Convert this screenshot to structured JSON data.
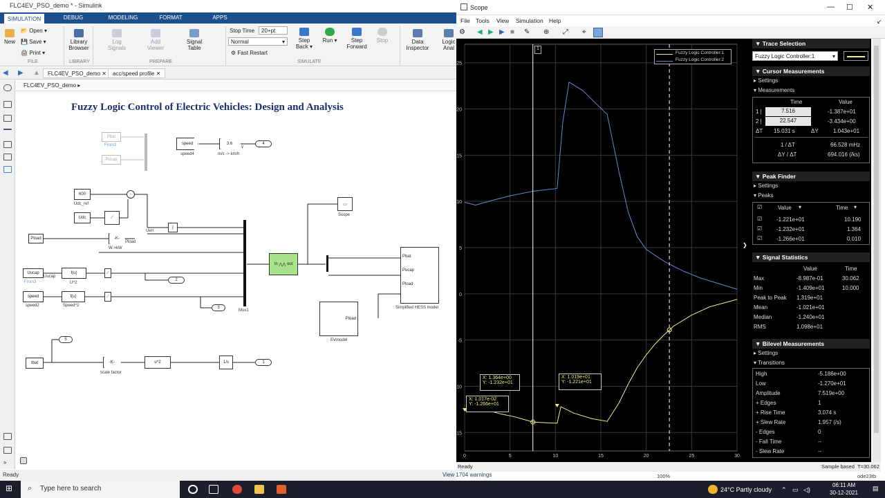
{
  "simulink": {
    "window_title": "FLC4EV_PSO_demo * - Simulink",
    "tabs": [
      "SIMULATION",
      "DEBUG",
      "MODELING",
      "FORMAT",
      "APPS"
    ],
    "ribbon": {
      "file": {
        "new": "New",
        "open": "Open",
        "save": "Save",
        "print": "Print",
        "section": "FILE"
      },
      "library": {
        "browser": "Library Browser",
        "section": "LIBRARY"
      },
      "prepare": {
        "log_signals": "Log Signals",
        "add_viewer": "Add Viewer",
        "signal_table": "Signal Table",
        "section": "PREPARE"
      },
      "simulate": {
        "stop_time_label": "Stop Time",
        "stop_time_value": "20+pt",
        "mode": "Normal",
        "fast_restart": "Fast Restart",
        "step_back": "Step Back",
        "run": "Run",
        "step_forward": "Step Forward",
        "stop": "Stop",
        "section": "SIMULATE"
      },
      "review": {
        "data_inspector": "Data Inspector",
        "logic_analyzer": "Logic Anal"
      }
    },
    "doc_tabs": [
      "FLC4EV_PSO_demo",
      "acc/speed profile"
    ],
    "breadcrumb": "FLC4EV_PSO_demo",
    "model_title": "Fuzzy Logic Control of Electric Vehicles: Design and Analysis",
    "blocks": {
      "speed4": "speed",
      "speed4_lbl": "speed4",
      "gain36": "3.6",
      "v": "v",
      "ms_kmh": "m/s -> km/h",
      "out4": "4",
      "pbat_g": "Pbat",
      "from2": "From2",
      "pucap_g": "Pucap",
      "c600": "600",
      "udc_ref": "Udc_ref",
      "udc": "Udc",
      "uerr": "Uerr",
      "pload": "Pload",
      "kgain": "-K-",
      "w_kw": "W->kW",
      "pload2": "Pload",
      "uucap": "Uucap",
      "from3": "From3",
      "uucap2": "Uucap",
      "fu": "f(u)",
      "u2": "U^2",
      "out2": "2",
      "speed2": "speed",
      "speed2_lbl": "speed2",
      "fu2": "f(u)",
      "speedsq": "Speed^2",
      "out3": "3",
      "mux": "Mux1",
      "scope": "Scope",
      "flc_in": "In",
      "flc_out": "out",
      "hess_pbat": "Pbat",
      "hess_pucap": "Pucap",
      "hess_pload": "Pload",
      "hess": "Simplified HESS model",
      "ev_pload": "Pload",
      "evmodel": "EVmodel",
      "out5": "5",
      "ibat": "Ibat",
      "scale": "scale factor",
      "usq": "u^2",
      "integ": "1/s",
      "out1": "1"
    },
    "status": {
      "left": "Ready",
      "warnings": "View 1704 warnings",
      "zoom": "100%"
    }
  },
  "scope": {
    "window_title": "Scope",
    "menu": [
      "File",
      "Tools",
      "View",
      "Simulation",
      "Help"
    ],
    "legend": [
      "Fuzzy Logic  Controller:1",
      "Fuzzy Logic  Controller:2"
    ],
    "cursor_tag": "1",
    "y_ticks": [
      "25",
      "20",
      "15",
      "10",
      "5",
      "0",
      "-5",
      "-10",
      "-15"
    ],
    "x_ticks": [
      "0",
      "5",
      "10",
      "15",
      "20",
      "25",
      "30"
    ],
    "tips": [
      {
        "x": "X:  1.364e+00",
        "y": "Y: -1.232e+01"
      },
      {
        "x": "X:  1.017e-02",
        "y": "Y: -1.266e+01"
      },
      {
        "x": "X:  1.019e+01",
        "y": "Y: -1.221e+01"
      }
    ],
    "status": {
      "left": "Ready",
      "sample": "Sample based",
      "time": "T=30.062"
    },
    "colors": {
      "trace1": "#f0f08a",
      "trace2": "#5b8fd6",
      "grid": "#3a3a3a",
      "bg": "#000000"
    }
  },
  "chart_data": {
    "type": "line",
    "xlim": [
      0,
      30
    ],
    "ylim": [
      -17,
      27
    ],
    "series": [
      {
        "name": "Fuzzy Logic  Controller:1",
        "x": [
          0,
          1.36,
          2.5,
          4,
          5.5,
          7.516,
          9,
          10.19,
          10.6,
          12,
          14,
          15.7,
          17,
          18,
          19,
          20,
          21,
          22,
          23,
          25,
          27,
          30
        ],
        "y": [
          -12.66,
          -12.32,
          -12.6,
          -13.0,
          -13.3,
          -13.87,
          -13.95,
          -14.0,
          -12.21,
          -12.9,
          -13.5,
          -13.8,
          -11.8,
          -9.8,
          -8.0,
          -6.6,
          -5.4,
          -4.4,
          -3.5,
          -2.3,
          -1.4,
          -0.6
        ]
      },
      {
        "name": "Fuzzy Logic  Controller:2",
        "x": [
          0,
          1.2,
          3,
          5,
          7.5,
          10.19,
          10.8,
          11.5,
          13,
          15.7,
          17,
          18,
          19,
          20,
          22,
          24,
          26,
          28,
          30
        ],
        "y": [
          9.9,
          9.6,
          10.1,
          10.6,
          11.1,
          11.4,
          18.5,
          22.9,
          22.0,
          19.4,
          13.2,
          8.9,
          6.2,
          4.8,
          3.5,
          2.5,
          1.7,
          1.1,
          0.5
        ]
      }
    ],
    "cursors": [
      7.516,
      22.547
    ]
  },
  "panel": {
    "trace_selection": {
      "title": "Trace Selection",
      "value": "Fuzzy Logic  Controller:1"
    },
    "cursor": {
      "title": "Cursor Measurements",
      "settings": "Settings",
      "measurements": "Measurements",
      "h_time": "Time",
      "h_value": "Value",
      "r1_idx": "1 |",
      "r1_time": "7.516",
      "r1_value": "-1.387e+01",
      "r2_idx": "2 |",
      "r2_time": "22.547",
      "r2_value": "-3.434e+00",
      "dt_lbl": "ΔT",
      "dt": "15.031 s",
      "dy_lbl": "ΔY",
      "dy": "1.043e+01",
      "inv_lbl": "1 / ΔT",
      "inv": "66.528 mHz",
      "slope_lbl": "ΔY / ΔT",
      "slope": "694.016 (/ks)"
    },
    "peak": {
      "title": "Peak Finder",
      "settings": "Settings",
      "peaks": "Peaks",
      "h_value": "Value",
      "h_time": "Time",
      "rows": [
        {
          "value": "-1.221e+01",
          "time": "10.190"
        },
        {
          "value": "-1.232e+01",
          "time": "1.364"
        },
        {
          "value": "-1.266e+01",
          "time": "0.010"
        }
      ]
    },
    "stats": {
      "title": "Signal Statistics",
      "h_value": "Value",
      "h_time": "Time",
      "rows": [
        {
          "label": "Max",
          "value": "-8.987e-01",
          "time": "30.062"
        },
        {
          "label": "Min",
          "value": "-1.409e+01",
          "time": "10.000"
        },
        {
          "label": "Peak to Peak",
          "value": "1.319e+01",
          "time": ""
        },
        {
          "label": "Mean",
          "value": "-1.021e+01",
          "time": ""
        },
        {
          "label": "Median",
          "value": "-1.240e+01",
          "time": ""
        },
        {
          "label": "RMS",
          "value": "1.098e+01",
          "time": ""
        }
      ]
    },
    "bilevel": {
      "title": "Bilevel Measurements",
      "settings": "Settings",
      "transitions": "Transitions",
      "rows": [
        {
          "label": "High",
          "value": "-5.186e+00"
        },
        {
          "label": "Low",
          "value": "-1.270e+01"
        },
        {
          "label": "Amplitude",
          "value": "7.519e+00"
        },
        {
          "label": "+ Edges",
          "value": "1"
        },
        {
          "label": "+ Rise Time",
          "value": "3.074 s"
        },
        {
          "label": "+ Slew Rate",
          "value": "1.957 (/s)"
        },
        {
          "label": "- Edges",
          "value": "0"
        },
        {
          "label": "- Fall Time",
          "value": "--"
        },
        {
          "label": "- Slew Rate",
          "value": "--"
        }
      ]
    }
  },
  "taskbar": {
    "search": "Type here to search",
    "weather": "24°C  Partly cloudy",
    "time": "06:11 AM",
    "date": "30-12-2021"
  },
  "misc": {
    "ode": "ode23tb"
  }
}
